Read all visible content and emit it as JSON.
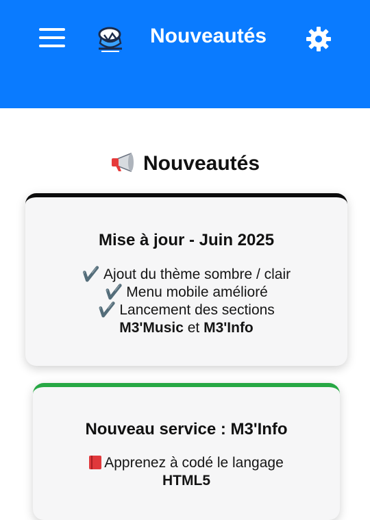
{
  "header": {
    "title": "Nouveautés"
  },
  "page": {
    "title": "Nouveautés"
  },
  "cards": [
    {
      "title": "Mise à jour - Juin 2025",
      "line1": "Ajout du thème sombre / clair",
      "line2": "Menu mobile amélioré",
      "line3": "Lancement des sections",
      "line4_part1": "M3'Music",
      "line4_sep": " et ",
      "line4_part2": "M3'Info",
      "accent": "#0c0c0c"
    },
    {
      "title": "Nouveau service : M3'Info",
      "line1": "Apprenez à codé le langage",
      "line2": "HTML5",
      "accent": "#27a844"
    }
  ],
  "icons": {
    "menu": "hamburger-icon",
    "logo": "logo-icon",
    "settings": "gear-icon",
    "megaphone": "megaphone-icon",
    "check": "check-mark-icon",
    "book": "book-icon"
  },
  "colors": {
    "header_bg": "#0a7bff",
    "header_text": "#ffffff",
    "card_bg": "#f6f6f7"
  }
}
